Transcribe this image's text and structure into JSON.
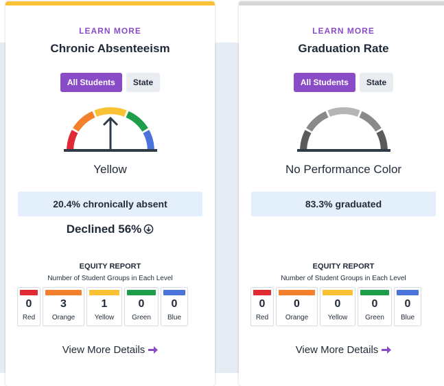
{
  "colors": {
    "accent": "#8a4bc6",
    "red": "#e02b35",
    "orange": "#f4802b",
    "yellow": "#f9c234",
    "green": "#1e9e4a",
    "blue": "#4a74d9",
    "gray_dark": "#5b5b5b",
    "gray_mid": "#8a8a8a",
    "gray_light": "#b5b5b5"
  },
  "cards": [
    {
      "learn_more": "LEARN MORE",
      "title": "Chronic Absenteeism",
      "toggle_all": "All Students",
      "toggle_state": "State",
      "gauge_icon": "performance-gauge-yellow",
      "color_label": "Yellow",
      "metric": "20.4% chronically absent",
      "change": "Declined 56%",
      "equity_title": "EQUITY REPORT",
      "equity_sub": "Number of Student Groups in Each Level",
      "levels": [
        {
          "count": "0",
          "name": "Red"
        },
        {
          "count": "3",
          "name": "Orange"
        },
        {
          "count": "1",
          "name": "Yellow"
        },
        {
          "count": "0",
          "name": "Green"
        },
        {
          "count": "0",
          "name": "Blue"
        }
      ],
      "view_more": "View More Details"
    },
    {
      "learn_more": "LEARN MORE",
      "title": "Graduation Rate",
      "toggle_all": "All Students",
      "toggle_state": "State",
      "gauge_icon": "performance-gauge-none",
      "color_label": "No Performance Color",
      "metric": "83.3% graduated",
      "equity_title": "EQUITY REPORT",
      "equity_sub": "Number of Student Groups in Each Level",
      "levels": [
        {
          "count": "0",
          "name": "Red"
        },
        {
          "count": "0",
          "name": "Orange"
        },
        {
          "count": "0",
          "name": "Yellow"
        },
        {
          "count": "0",
          "name": "Green"
        },
        {
          "count": "0",
          "name": "Blue"
        }
      ],
      "view_more": "View More Details"
    }
  ]
}
